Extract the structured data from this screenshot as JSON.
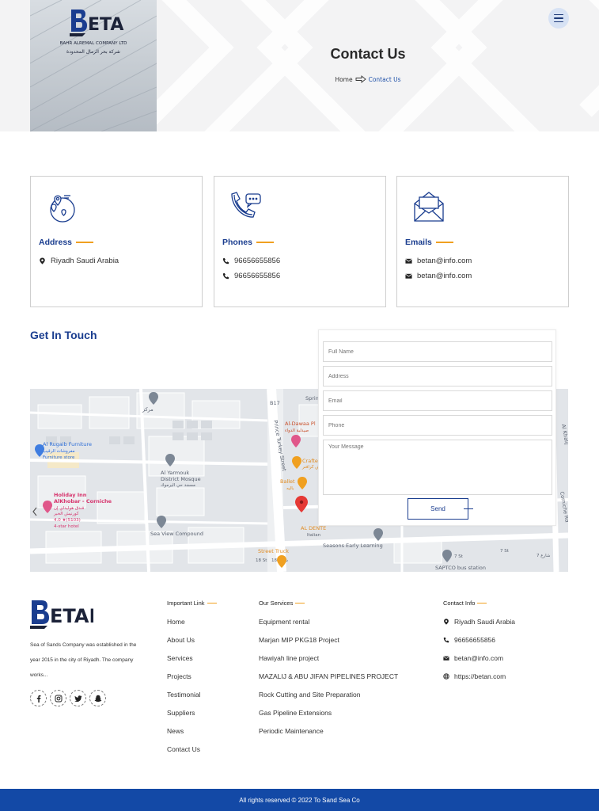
{
  "brand": {
    "logo_text": "ETAN",
    "company_en": "BAHR ALREMAL COMPANY LTD",
    "company_ar": "شركة بحر الرمال المحدودة"
  },
  "hero": {
    "title": "Contact Us",
    "breadcrumb_home": "Home",
    "breadcrumb_current": "Contact Us"
  },
  "cards": {
    "address": {
      "title": "Address",
      "lines": [
        "Riyadh Saudi Arabia"
      ]
    },
    "phones": {
      "title": "Phones",
      "lines": [
        "96656655856",
        "96656655856"
      ]
    },
    "emails": {
      "title": "Emails",
      "lines": [
        "betan@info.com",
        "betan@info.com"
      ]
    }
  },
  "contact_form": {
    "heading": "Get In Touch",
    "full_name_placeholder": "Full Name",
    "address_placeholder": "Address",
    "email_placeholder": "Email",
    "phone_placeholder": "Phone",
    "message_placeholder": "Your Message",
    "send_label": "Send"
  },
  "map": {
    "labels": {
      "al_rugaib": "Al Rugaib Furniture",
      "al_rugaib_ar": "مفروشات الرقيب",
      "al_rugaib_type": "Furniture store",
      "al_yarmouk": "Al Yarmouk",
      "al_yarmouk_2": "District Mosque",
      "al_yarmouk_ar": "مسجد حي اليرموك",
      "holiday_inn": "Holiday Inn",
      "holiday_inn_2": "AlKhobar - Corniche",
      "holiday_inn_ar": "فندق هوليداي إن",
      "holiday_inn_ar_2": "كورنيش الخبر",
      "holiday_inn_rating": "4.0 ★(5103)",
      "holiday_inn_type": "4-star hotel",
      "sea_view": "Sea View Compound",
      "prince_turkey": "Prince Turkey Street",
      "al_dawaa": "Al-Dawaa Pl",
      "al_dawaa_ar": "صيدلية الدواء",
      "crafter": "Crafte",
      "crafter_ar": "ش كرافتر",
      "ballet": "Ballet",
      "ballet_ar": "باليه",
      "al_dente": "AL DENTE",
      "al_dente_type": "Italian",
      "seasons": "Seasons Early Learning",
      "street_truck": "Street Truck",
      "saptco": "SAPTCO bus station",
      "corniche": "Corniche Rd",
      "al_khalij": "Al Khalij",
      "markaz": "مركز",
      "b17": "B17",
      "sprin": "Sprin",
      "st_18": "18 St",
      "st_18_ar": "شارع 18",
      "st_7": "7 St",
      "st_7b": "7 St",
      "st_7_ar": "شارع 7"
    }
  },
  "footer": {
    "about": "Sea of Sands Company was established in the year 2015 in the city of Riyadh. The company works...",
    "important_links_title": "Important Link",
    "important_links": [
      "Home",
      "About Us",
      "Services",
      "Projects",
      "Testimonial",
      "Suppliers",
      "News",
      "Contact Us"
    ],
    "services_title": "Our Services",
    "services": [
      "Equipment rental",
      "Marjan MIP PKG18 Project",
      "Hawiyah line project",
      "MAZALIJ & ABU JIFAN PIPELINES PROJECT",
      "Rock Cutting and Site Preparation",
      "Gas Pipeline Extensions",
      "Periodic Maintenance"
    ],
    "contact_title": "Contact Info",
    "contact_address": "Riyadh Saudi Arabia",
    "contact_phone": "96656655856",
    "contact_email": "betan@info.com",
    "contact_website": "https://betan.com",
    "copyright": "All rights reserved © 2022 To Sand Sea Co"
  },
  "colors": {
    "primary_blue": "#1a3d8f",
    "accent_orange": "#f0a020",
    "footer_bar": "#1349a6"
  },
  "icons": [
    "menu-icon",
    "location-pin-icon",
    "phone-icon",
    "email-icon",
    "globe-icon",
    "facebook-icon",
    "instagram-icon",
    "twitter-icon",
    "snapchat-icon",
    "arrow-right-icon"
  ]
}
